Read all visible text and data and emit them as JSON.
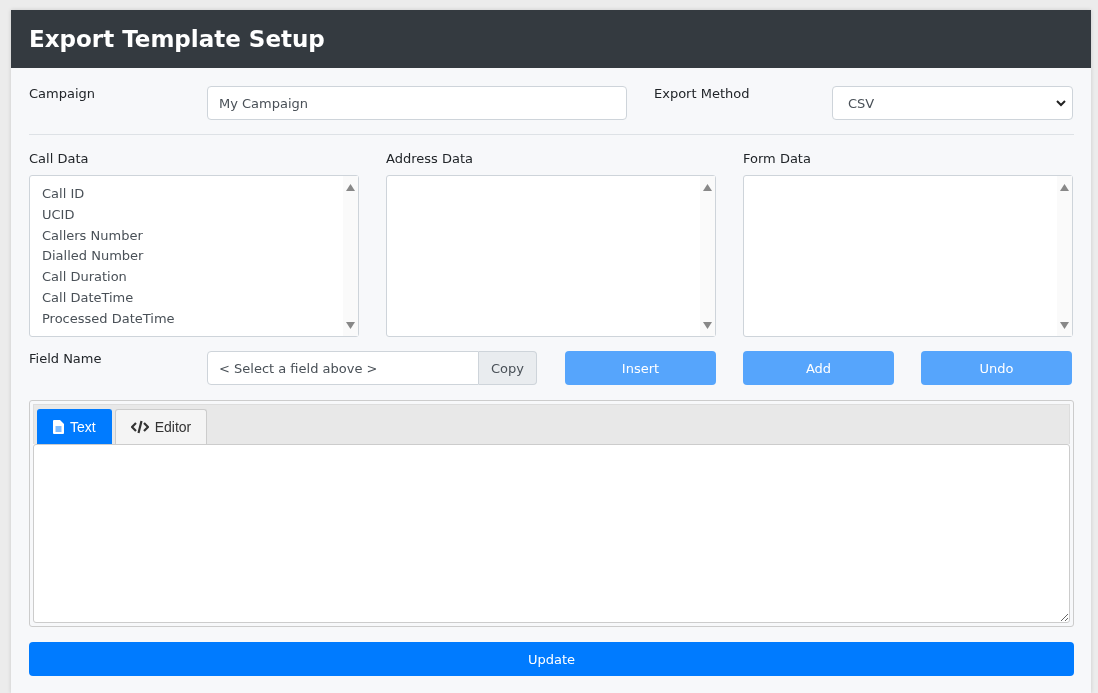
{
  "header": {
    "title": "Export Template Setup"
  },
  "campaign": {
    "label": "Campaign",
    "value": "My Campaign"
  },
  "export_method": {
    "label": "Export Method",
    "value": "CSV"
  },
  "lists": [
    {
      "label": "Call Data",
      "items": [
        "Call ID",
        "UCID",
        "Callers Number",
        "Dialled Number",
        "Call Duration",
        "Call DateTime",
        "Processed DateTime"
      ]
    },
    {
      "label": "Address Data"
    },
    {
      "label": "Form Data"
    }
  ],
  "field_name": {
    "label": "Field Name",
    "placeholder": "< Select a field above >",
    "copy_label": "Copy"
  },
  "actions": [
    {
      "label": "Insert",
      "disabled": true
    },
    {
      "label": "Add",
      "disabled": true
    },
    {
      "label": "Undo",
      "disabled": true
    }
  ],
  "tabs": [
    {
      "label": "Text",
      "kind": "text",
      "selected": true
    },
    {
      "label": "Editor",
      "kind": "code",
      "selected": false
    }
  ],
  "update_button": {
    "label": "Update"
  }
}
